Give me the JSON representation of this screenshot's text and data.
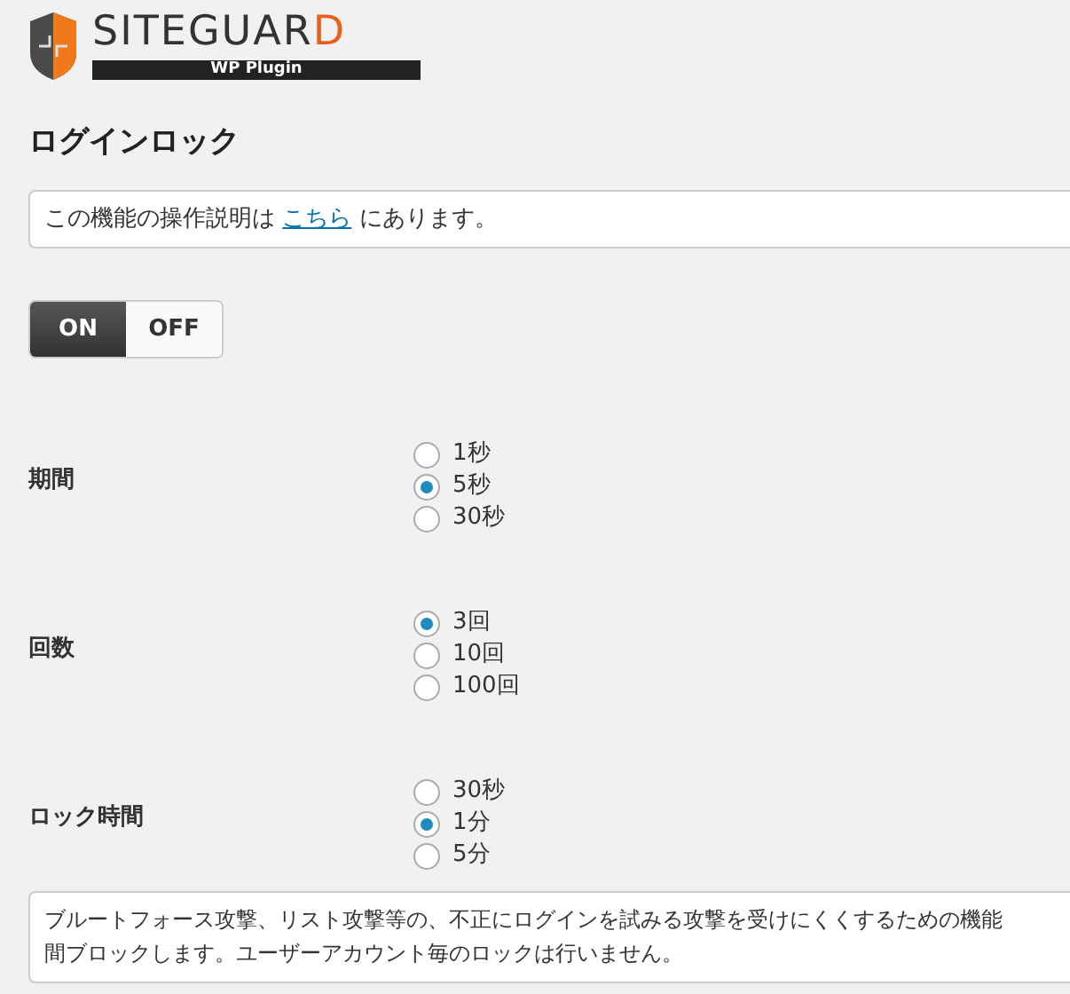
{
  "logo": {
    "name": "SITEGUARD",
    "tagline": "WP Plugin"
  },
  "title": "ログインロック",
  "notice": {
    "before": "この機能の操作説明は ",
    "link": "こちら",
    "after": " にあります。"
  },
  "toggle": [
    {
      "label": "ON",
      "selected": true
    },
    {
      "label": "OFF",
      "selected": false
    }
  ],
  "settings": [
    {
      "label": "期間",
      "options": [
        {
          "label": "1秒",
          "selected": false
        },
        {
          "label": "5秒",
          "selected": true
        },
        {
          "label": "30秒",
          "selected": false
        }
      ]
    },
    {
      "label": "回数",
      "options": [
        {
          "label": "3回",
          "selected": true
        },
        {
          "label": "10回",
          "selected": false
        },
        {
          "label": "100回",
          "selected": false
        }
      ]
    },
    {
      "label": "ロック時間",
      "options": [
        {
          "label": "30秒",
          "selected": false
        },
        {
          "label": "1分",
          "selected": true
        },
        {
          "label": "5分",
          "selected": false
        }
      ]
    }
  ],
  "description": [
    "ブルートフォース攻撃、リスト攻撃等の、不正にログインを試みる攻撃を受けにくくするための機能",
    "間ブロックします。ユーザーアカウント毎のロックは行いません。"
  ]
}
